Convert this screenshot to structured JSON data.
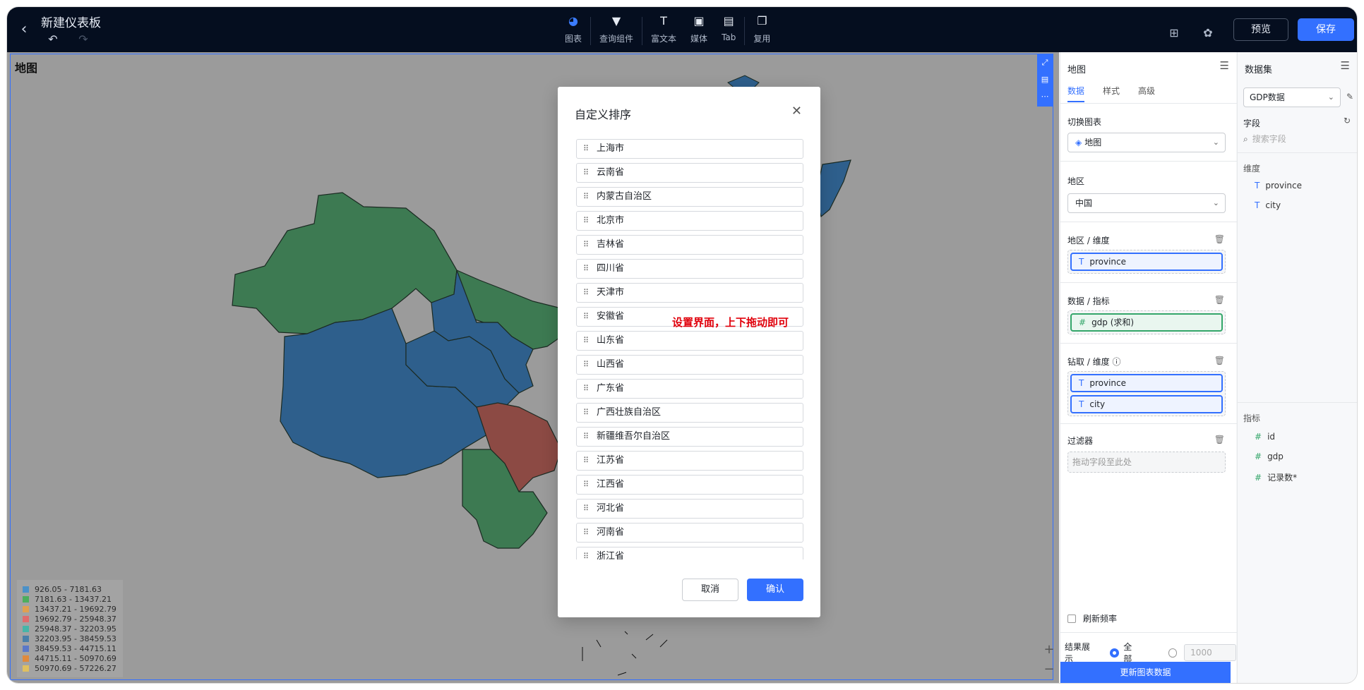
{
  "header": {
    "title": "新建仪表板",
    "tools": [
      {
        "label": "图表",
        "icon": "pie-chart-icon"
      },
      {
        "label": "查询组件",
        "icon": "filter-icon"
      },
      {
        "label": "富文本",
        "icon": "text-icon"
      },
      {
        "label": "媒体",
        "icon": "image-icon"
      },
      {
        "label": "Tab",
        "icon": "tab-icon"
      },
      {
        "label": "复用",
        "icon": "copy-icon"
      }
    ],
    "preview_label": "预览",
    "save_label": "保存"
  },
  "canvas": {
    "chart_title": "地图",
    "legend": [
      {
        "label": "926.05 - 7181.63",
        "color": "#4b91c8"
      },
      {
        "label": "7181.63 - 13437.21",
        "color": "#4cae5e"
      },
      {
        "label": "13437.21 - 19692.79",
        "color": "#e0a050"
      },
      {
        "label": "19692.79 - 25948.37",
        "color": "#e06c6c"
      },
      {
        "label": "25948.37 - 32203.95",
        "color": "#46b5a8"
      },
      {
        "label": "32203.95 - 38459.53",
        "color": "#4a7fa9"
      },
      {
        "label": "38459.53 - 44715.11",
        "color": "#5a78c8"
      },
      {
        "label": "44715.11 - 50970.69",
        "color": "#e08a3c"
      },
      {
        "label": "50970.69 - 57226.27",
        "color": "#e0c060"
      }
    ]
  },
  "panel": {
    "title": "地图",
    "tabs": [
      "数据",
      "样式",
      "高级"
    ],
    "switch_chart_label": "切换图表",
    "chart_type": "地图",
    "region_label": "地区",
    "region_value": "中国",
    "dimension_label": "地区 / 维度",
    "dimension_field": "province",
    "metric_label": "数据 / 指标",
    "metric_field": "gdp (求和)",
    "drill_label": "钻取 / 维度",
    "drill_fields": [
      "province",
      "city"
    ],
    "filter_label": "过滤器",
    "filter_placeholder": "拖动字段至此处",
    "refresh_label": "刷新频率",
    "result_label": "结果展示",
    "result_all": "全部",
    "result_limit": "1000",
    "update_button": "更新图表数据"
  },
  "dataset": {
    "title": "数据集",
    "selected": "GDP数据",
    "fields_label": "字段",
    "search_placeholder": "搜索字段",
    "dimension_group": "维度",
    "dimensions": [
      "province",
      "city"
    ],
    "metric_group": "指标",
    "metrics": [
      "id",
      "gdp",
      "记录数*"
    ]
  },
  "modal": {
    "title": "自定义排序",
    "items": [
      "上海市",
      "云南省",
      "内蒙古自治区",
      "北京市",
      "吉林省",
      "四川省",
      "天津市",
      "安徽省",
      "山东省",
      "山西省",
      "广东省",
      "广西壮族自治区",
      "新疆维吾尔自治区",
      "江苏省",
      "江西省",
      "河北省",
      "河南省",
      "浙江省"
    ],
    "cancel_label": "取消",
    "confirm_label": "确认"
  },
  "annotation": "设置界面，上下拖动即可"
}
